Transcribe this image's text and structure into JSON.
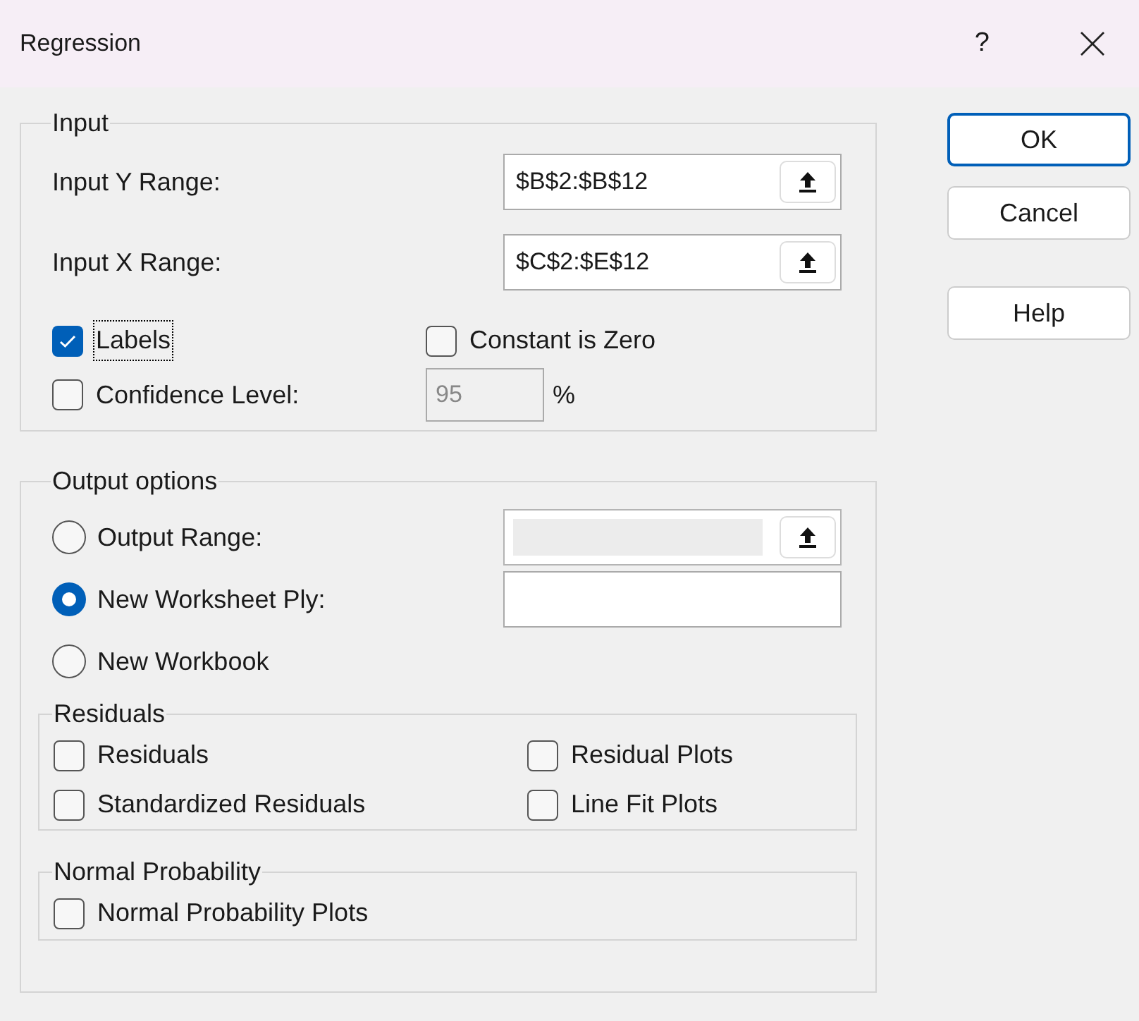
{
  "window": {
    "title": "Regression",
    "help": "?"
  },
  "input": {
    "legend": "Input",
    "ranges": [
      {
        "label": "Input Y Range:",
        "value": "$B$2:$B$12"
      },
      {
        "label": "Input X Range:",
        "value": "$C$2:$E$12"
      }
    ],
    "labels": {
      "label": "Labels",
      "checked": true,
      "focused": true
    },
    "constant_is_zero": {
      "label": "Constant is Zero",
      "checked": false
    },
    "confidence": {
      "label": "Confidence Level:",
      "checked": false,
      "value": "95",
      "unit": "%",
      "disabled": true
    }
  },
  "output": {
    "legend": "Output options",
    "destinations": [
      {
        "label": "Output Range:",
        "selected": false,
        "kind": "picker",
        "disabled": true
      },
      {
        "label": "New Worksheet Ply:",
        "selected": true,
        "kind": "text",
        "disabled": false
      },
      {
        "label": "New Workbook",
        "selected": false,
        "kind": "plain"
      }
    ],
    "residuals": {
      "legend": "Residuals",
      "options": [
        {
          "label": "Residuals",
          "checked": false
        },
        {
          "label": "Residual Plots",
          "checked": false
        },
        {
          "label": "Standardized Residuals",
          "checked": false
        },
        {
          "label": "Line Fit Plots",
          "checked": false
        }
      ]
    },
    "normal_probability": {
      "legend": "Normal Probability",
      "options": [
        {
          "label": "Normal Probability Plots",
          "checked": false
        }
      ]
    }
  },
  "buttons": [
    {
      "label": "OK",
      "default": true
    },
    {
      "label": "Cancel",
      "default": false
    },
    {
      "label": "Help",
      "default": false
    }
  ]
}
